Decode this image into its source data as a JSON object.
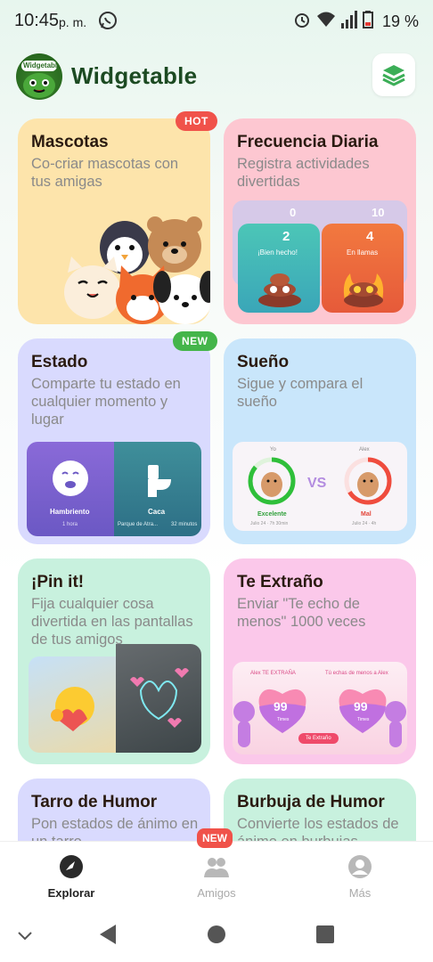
{
  "status_bar": {
    "time": "10:45",
    "ampm": "p. m.",
    "battery": "19 %"
  },
  "header": {
    "logo_text": "Widgetable",
    "title": "Widgetable"
  },
  "cards": {
    "mascotas": {
      "title": "Mascotas",
      "desc": "Co-criar mascotas con tus amigas",
      "badge": "HOT"
    },
    "frecuencia": {
      "title": "Frecuencia Diaria",
      "desc": "Registra actividades divertidas",
      "preview": {
        "back_left": "0",
        "back_right": "10",
        "left_count": "2",
        "left_label": "¡Bien hecho!",
        "right_count": "4",
        "right_label": "En llamas"
      }
    },
    "estado": {
      "title": "Estado",
      "desc": "Comparte tu estado en cualquier momento y lugar",
      "badge": "NEW",
      "preview": {
        "left_label": "Hambriento",
        "left_sub": "1 hora",
        "right_label": "Caca",
        "right_sub_left": "Parque de Atra...",
        "right_sub_right": "32 minutos"
      }
    },
    "sueno": {
      "title": "Sueño",
      "desc": "Sigue y compara el sueño",
      "preview": {
        "left_name": "Yo",
        "right_name": "Alex",
        "vs": "VS",
        "left_status": "Excelente",
        "left_time": "Julio 24 · 7h 30min",
        "right_status": "Mal",
        "right_time": "Julio 24 · 4h"
      }
    },
    "pin": {
      "title": "¡Pin it!",
      "desc": "Fija cualquier cosa divertida en las pantallas de tus amigos"
    },
    "extrano": {
      "title": "Te Extraño",
      "desc": "Enviar \"Te echo de menos\" 1000 veces",
      "preview": {
        "left_head": "Alex TE EXTRAÑA",
        "right_head": "Tú echas de menos a Alex",
        "left_num": "99",
        "right_num": "99",
        "left_unit": "Times",
        "right_unit": "Times",
        "button": "Te Extraño"
      }
    },
    "tarro": {
      "title": "Tarro de Humor",
      "desc": "Pon estados de ánimo en un tarro"
    },
    "burbuja": {
      "title": "Burbuja de Humor",
      "desc": "Convierte los estados de ánimo en burbujas"
    }
  },
  "bottom_nav": {
    "items": [
      {
        "label": "Explorar",
        "active": true
      },
      {
        "label": "Amigos",
        "badge": "NEW"
      },
      {
        "label": "Más"
      }
    ]
  },
  "colors": {
    "title_green": "#1c4a22",
    "hot": "#f0524a",
    "new": "#44b54a",
    "mascotas_bg": "#fde4ab",
    "frecuencia_bg": "#fdc7d1",
    "estado_bg": "#d9dafe",
    "sueno_bg": "#c9e6fb",
    "pin_bg": "#c8f1de",
    "extrano_bg": "#fbc8ea"
  }
}
